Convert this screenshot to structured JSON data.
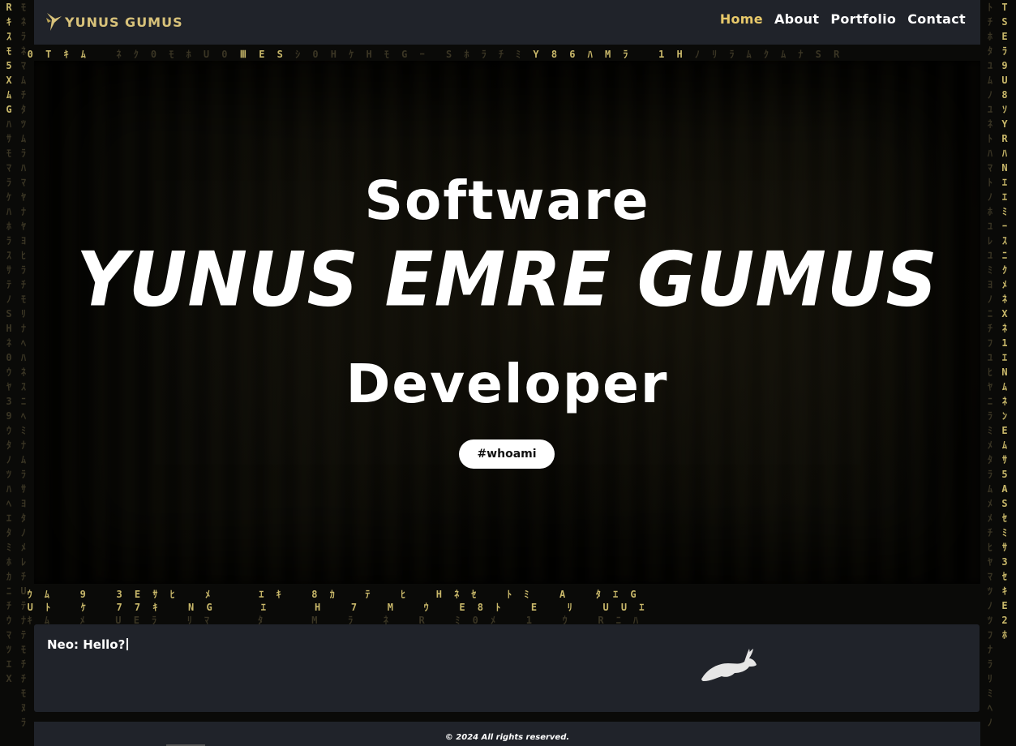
{
  "header": {
    "logo_text": "YUNUS GUMUS",
    "nav": [
      {
        "label": "Home",
        "active": true
      },
      {
        "label": "About",
        "active": false
      },
      {
        "label": "Portfolio",
        "active": false
      },
      {
        "label": "Contact",
        "active": false
      }
    ]
  },
  "hero": {
    "line1": "Software",
    "line2": "Yunus Emre Gumus",
    "line3": "Developer",
    "button_label": "#whoami"
  },
  "terminal": {
    "text": "Neo: Hello?",
    "icon": "rabbit-icon"
  },
  "footer": {
    "copyright": "© 2024 All rights reserved."
  },
  "colors": {
    "accent": "#e8c96a",
    "panel": "#20232a",
    "background": "#0a0a08",
    "matrix_bright": "#c9b86a"
  }
}
